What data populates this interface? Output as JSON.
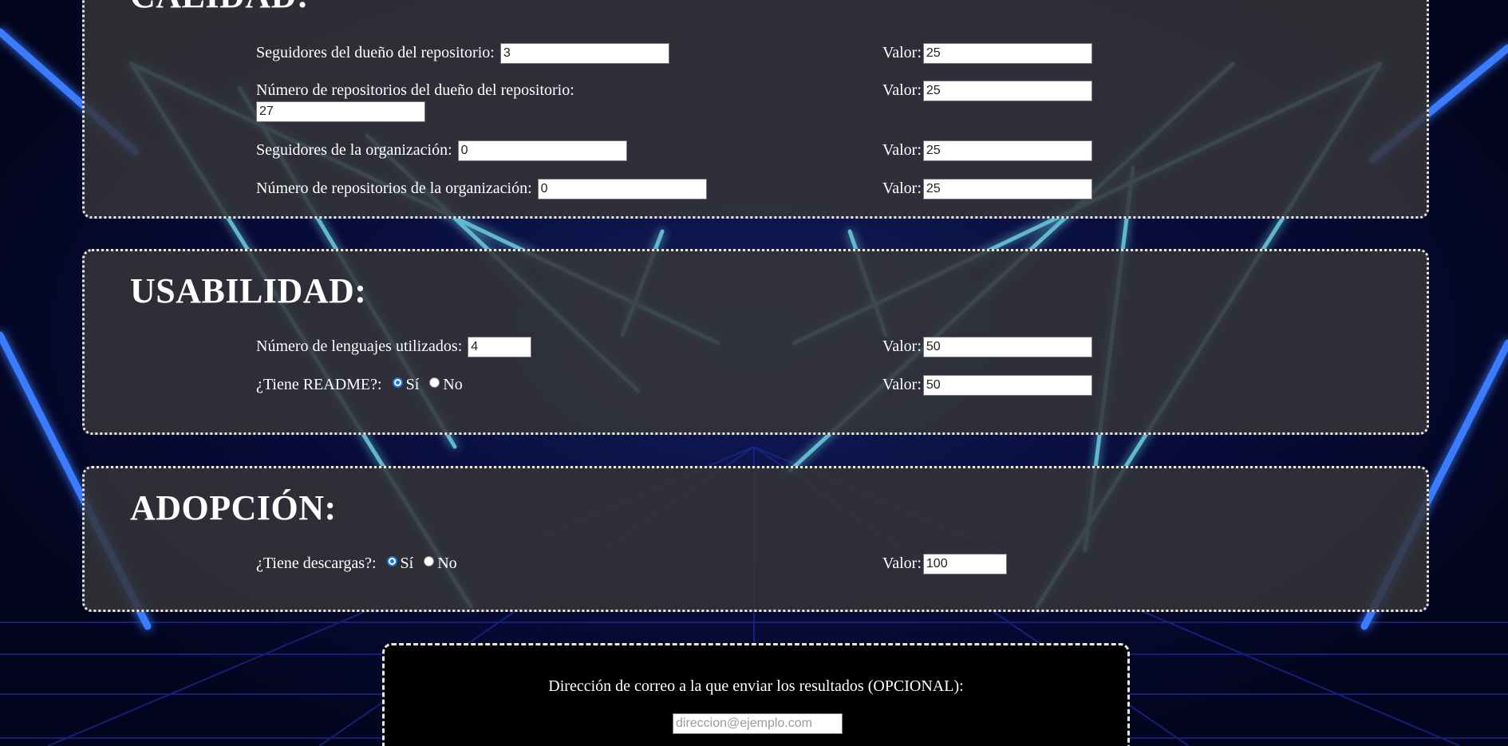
{
  "calidad": {
    "title": "CALIDAD:",
    "rows": [
      {
        "label": "Seguidores del dueño del repositorio:",
        "value": "3",
        "valor_label": "Valor:",
        "valor": "25"
      },
      {
        "label": "Número de repositorios del dueño del repositorio:",
        "value": "27",
        "valor_label": "Valor:",
        "valor": "25"
      },
      {
        "label": "Seguidores de la organización:",
        "value": "0",
        "valor_label": "Valor:",
        "valor": "25"
      },
      {
        "label": "Número de repositorios de la organización:",
        "value": "0",
        "valor_label": "Valor:",
        "valor": "25"
      }
    ]
  },
  "usabilidad": {
    "title": "USABILIDAD:",
    "lenguajes": {
      "label": "Número de lenguajes utilizados:",
      "value": "4",
      "valor_label": "Valor:",
      "valor": "50"
    },
    "readme": {
      "label": "¿Tiene README?:",
      "option_yes": "Sí",
      "option_no": "No",
      "selected": "Sí",
      "valor_label": "Valor:",
      "valor": "50"
    }
  },
  "adopcion": {
    "title": "ADOPCIÓN:",
    "descargas": {
      "label": "¿Tiene descargas?:",
      "option_yes": "Sí",
      "option_no": "No",
      "selected": "Sí",
      "valor_label": "Valor:",
      "valor": "100"
    }
  },
  "email": {
    "label": "Dirección de correo a la que enviar los resultados (OPCIONAL):",
    "placeholder": "direccion@ejemplo.com",
    "value": ""
  },
  "colors": {
    "background": "#03051e",
    "neon_blue": "#3a7bff",
    "neon_cyan": "#6fd6e6",
    "panel": "#343438",
    "radio_checked": "#1a73e8"
  }
}
